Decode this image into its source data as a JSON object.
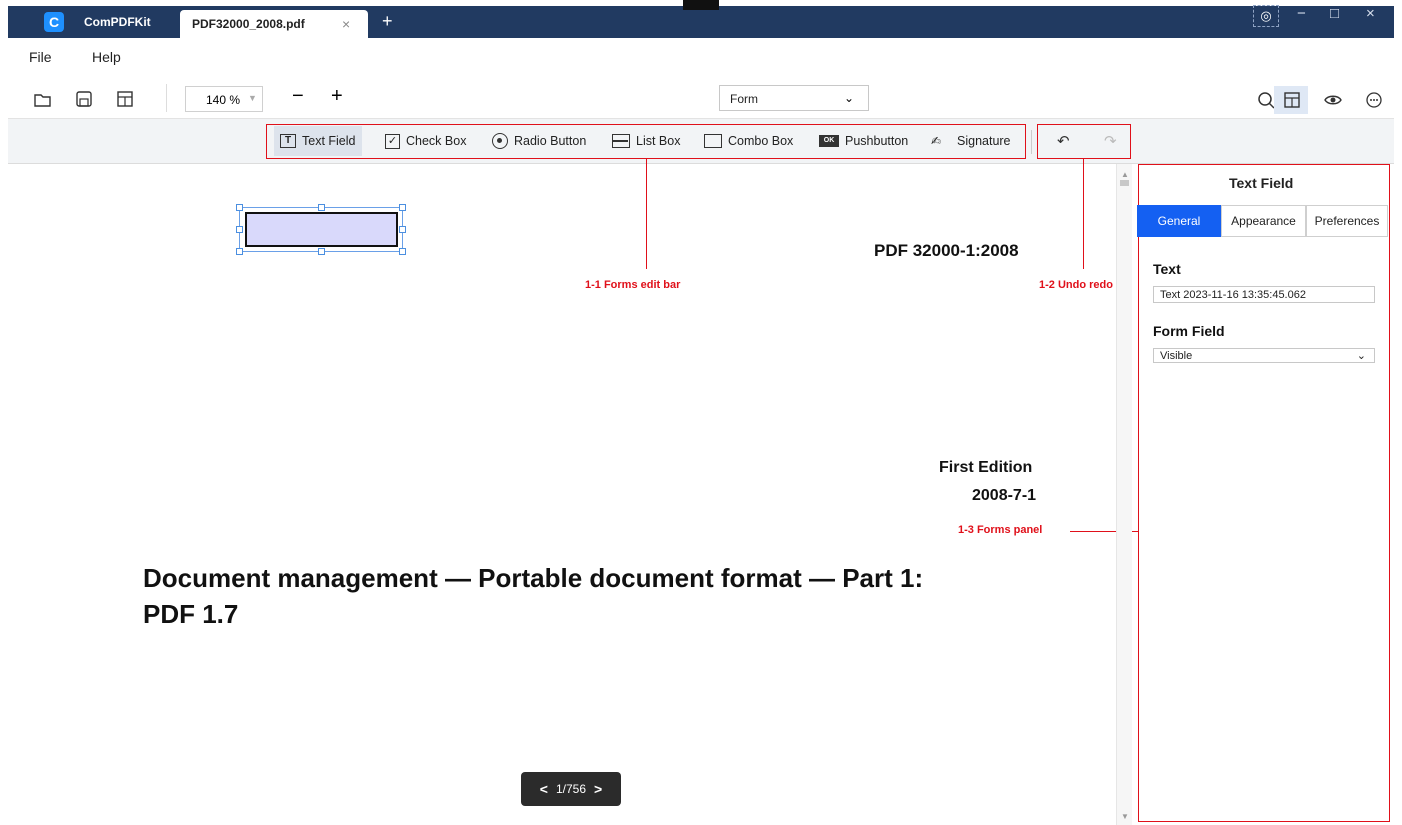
{
  "app": {
    "name": "ComPDFKit",
    "logo_letter": "C"
  },
  "tabs": [
    {
      "label": "PDF32000_2008.pdf",
      "close": "×"
    }
  ],
  "new_tab": "+",
  "window": {
    "minimize": "−",
    "maximize": "□",
    "close": "×"
  },
  "menu": {
    "file": "File",
    "help": "Help"
  },
  "toolbar": {
    "zoom_value": "140 %",
    "zoom_out": "−",
    "zoom_in": "+",
    "mode": "Form"
  },
  "forms_bar": {
    "tools": [
      "Text Field",
      "Check Box",
      "Radio Button",
      "List Box",
      "Combo Box",
      "Pushbutton",
      "Signature"
    ],
    "ok_badge": "OK"
  },
  "annotations": {
    "edit_bar": "1-1 Forms edit bar",
    "undo_redo": "1-2 Undo redo",
    "forms_panel": "1-3 Forms panel"
  },
  "document": {
    "standard": "PDF 32000-1:2008",
    "edition": "First Edition",
    "date": "2008-7-1",
    "title_line1": "Document management — Portable document format — Part 1:",
    "title_line2": "PDF 1.7"
  },
  "panel": {
    "title": "Text Field",
    "tabs": [
      "General",
      "Appearance",
      "Preferences"
    ],
    "text_label": "Text",
    "text_value": "Text 2023-11-16 13:35:45.062",
    "form_field_label": "Form Field",
    "form_field_value": "Visible"
  },
  "pager": {
    "page": "1/756",
    "prev": "<",
    "next": ">"
  },
  "colors": {
    "titlebar": "#213a61",
    "accent": "#1460f2",
    "annotation": "#e0101a",
    "field_fill": "#d9d9fb"
  }
}
